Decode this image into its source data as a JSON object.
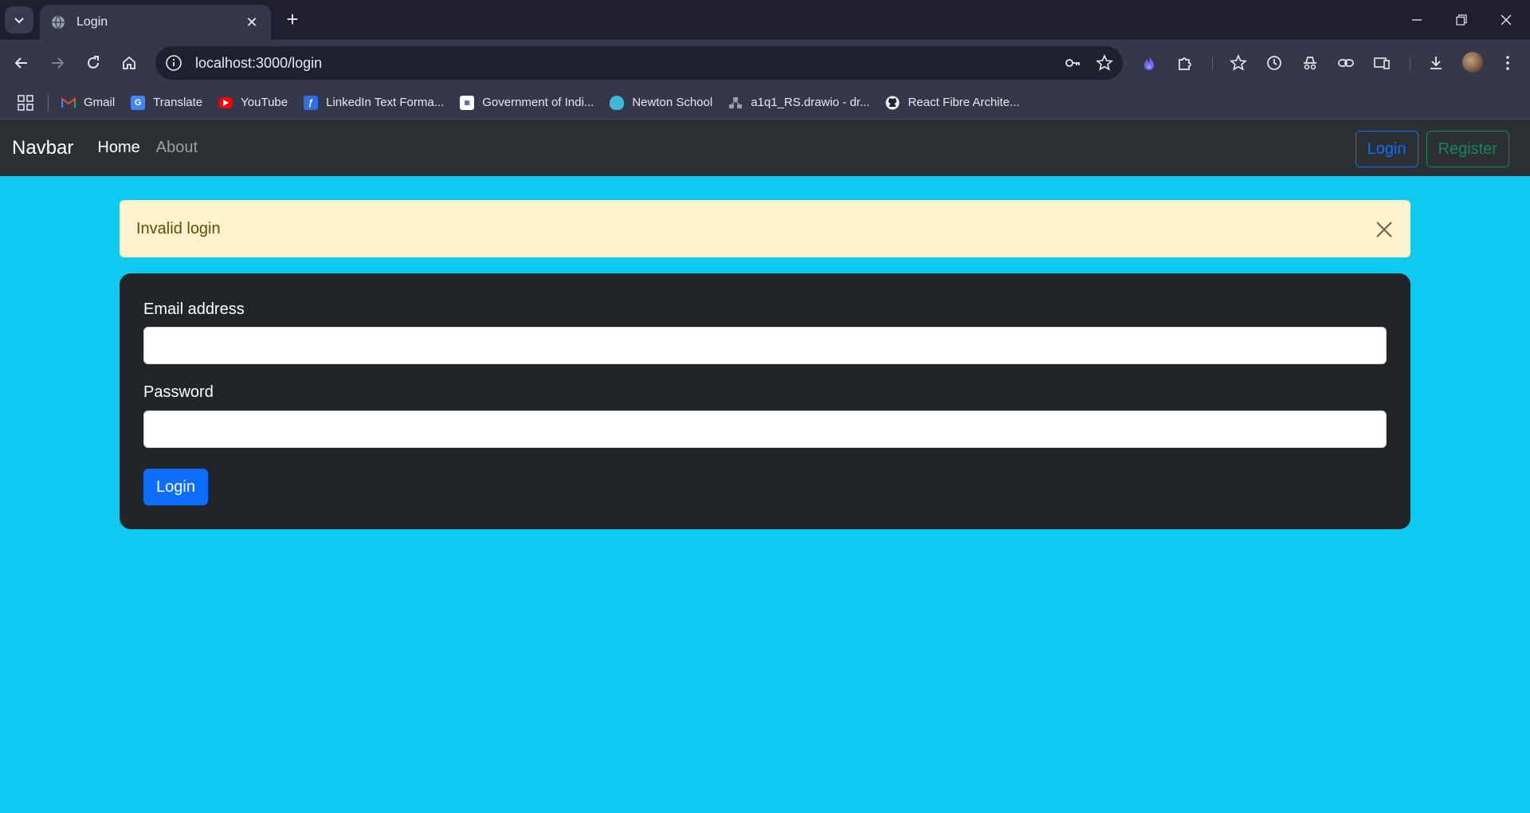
{
  "browser": {
    "tab": {
      "title": "Login"
    },
    "address": {
      "url": "localhost:3000/login"
    },
    "bookmarks": [
      {
        "label": "Gmail",
        "icon": "gmail-icon"
      },
      {
        "label": "Translate",
        "icon": "translate-icon"
      },
      {
        "label": "YouTube",
        "icon": "youtube-icon"
      },
      {
        "label": "LinkedIn Text Forma...",
        "icon": "linkedin-formatter-icon"
      },
      {
        "label": "Government of Indi...",
        "icon": "government-icon"
      },
      {
        "label": "Newton School",
        "icon": "newton-school-icon"
      },
      {
        "label": "a1q1_RS.drawio - dr...",
        "icon": "drawio-icon"
      },
      {
        "label": "React  Fibre Archite...",
        "icon": "github-icon"
      }
    ]
  },
  "navbar": {
    "brand": "Navbar",
    "links": [
      "Home",
      "About"
    ],
    "login_label": "Login",
    "register_label": "Register"
  },
  "alert": {
    "message": "Invalid login"
  },
  "form": {
    "email_label": "Email address",
    "email_value": "",
    "password_label": "Password",
    "password_value": "",
    "submit_label": "Login"
  },
  "colors": {
    "page_background": "#0dcaf0",
    "navbar_background": "#2b3035",
    "card_background": "#212529",
    "primary": "#0d6efd",
    "success": "#198754",
    "alert_background": "#fff3cd",
    "alert_text": "#664d03"
  }
}
